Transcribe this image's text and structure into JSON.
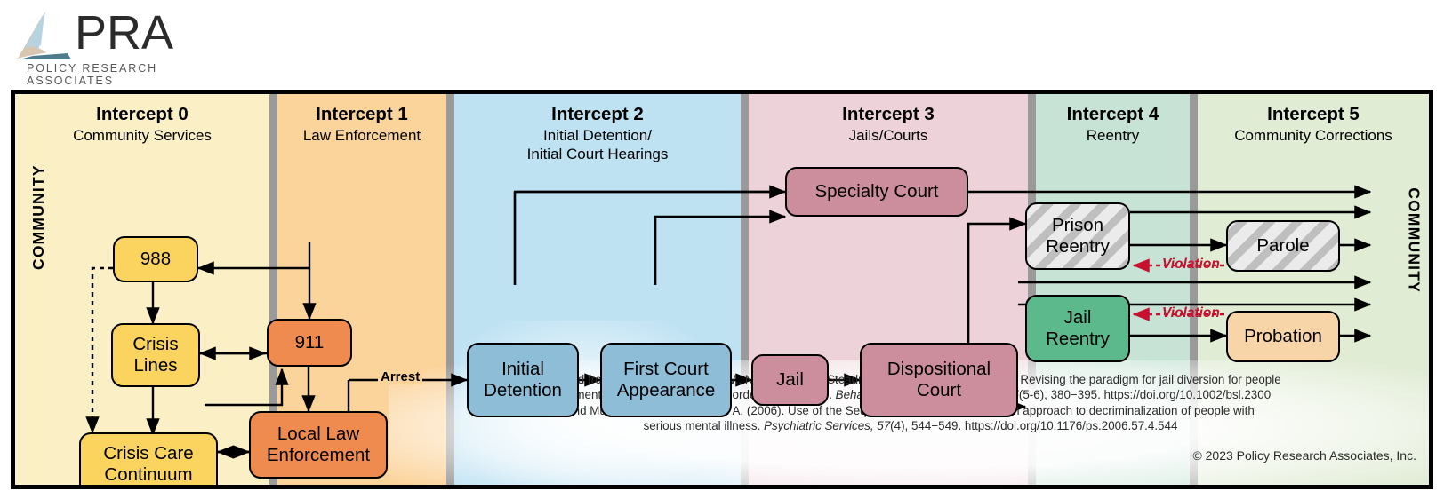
{
  "logo": {
    "wordmark": "PRA",
    "tagline": "POLICY RESEARCH ASSOCIATES",
    "colors": {
      "light_blue": "#b8d3e0",
      "tan": "#d9c6b0",
      "teal": "#4d7c8a"
    }
  },
  "frame": {
    "left_rail_label": "COMMUNITY",
    "right_rail_label": "COMMUNITY"
  },
  "columns": [
    {
      "number": "Intercept 0",
      "name": "Community Services",
      "color": "#FBEFC5"
    },
    {
      "number": "Intercept 1",
      "name": "Law Enforcement",
      "color": "#FBD49C"
    },
    {
      "number": "Intercept 2",
      "name": "Initial Detention/",
      "name2": "Initial Court Hearings",
      "color": "#BFE2F3"
    },
    {
      "number": "Intercept 3",
      "name": "Jails/Courts",
      "color": "#EDD3D9"
    },
    {
      "number": "Intercept 4",
      "name": "Reentry",
      "color": "#C6E3D5"
    },
    {
      "number": "Intercept 5",
      "name": "Community Corrections",
      "color": "#E1ECD5"
    }
  ],
  "nodes": {
    "n988": {
      "label": "988",
      "fill": "#FBD45F"
    },
    "crisis_lines": {
      "label": "Crisis\nLines",
      "fill": "#FBD45F"
    },
    "crisis_care": {
      "label": "Crisis Care\nContinuum",
      "fill": "#FBD45F"
    },
    "n911": {
      "label": "911",
      "fill": "#F08B4F"
    },
    "local_law": {
      "label": "Local Law\nEnforcement",
      "fill": "#F08B4F"
    },
    "initial_det": {
      "label": "Initial\nDetention",
      "fill": "#8EBDD8"
    },
    "first_court": {
      "label": "First Court\nAppearance",
      "fill": "#8EBDD8"
    },
    "specialty_court": {
      "label": "Specialty Court",
      "fill": "#CC8E9C"
    },
    "jail": {
      "label": "Jail",
      "fill": "#CC8E9C"
    },
    "disp_court": {
      "label": "Dispositional\nCourt",
      "fill": "#CC8E9C"
    },
    "prison_reentry": {
      "label": "Prison\nReentry",
      "fill": "#EBEBEB",
      "hatched": true
    },
    "jail_reentry": {
      "label": "Jail\nReentry",
      "fill": "#5CB98C"
    },
    "parole": {
      "label": "Parole",
      "fill": "#EBEBEB",
      "hatched": true
    },
    "probation": {
      "label": "Probation",
      "fill": "#F8D5A8"
    }
  },
  "edge_labels": {
    "arrest": "Arrest",
    "violation_parole": "Violation",
    "violation_probation": "Violation",
    "violation_color": "#C8102E"
  },
  "citation": {
    "line1": "Adapted from Abreu, D., Parker, T. W., Noether, C. D., Steadman, H. J., & Case, B. (2017). Revising the paradigm for jail diversion for people",
    "line2a": "with mental and substance use disorders: Intercept 0. ",
    "line2_italic": "Behavioral Sciences & the Law, 35",
    "line2b": "(5-6), 380−395. https://doi.org/10.1002/bsl.2300",
    "line3": "and Munetz, M. R., & Griffin, P. A. (2006). Use of the Sequential Intercept Model as an approach to decriminalization of people with",
    "line4a": "serious mental illness. ",
    "line4_italic": "Psychiatric Services, 57",
    "line4b": "(4), 544−549. https://doi.org/10.1176/ps.2006.57.4.544"
  },
  "copyright": "© 2023 Policy Research Associates, Inc."
}
